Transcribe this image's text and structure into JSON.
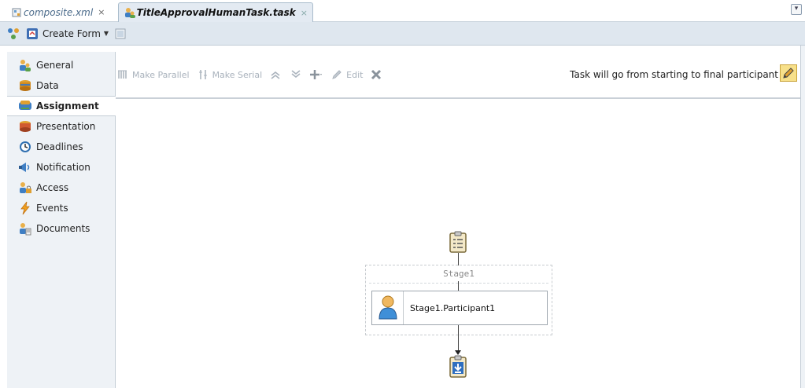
{
  "tabs": [
    {
      "label": "composite.xml",
      "close": "×"
    },
    {
      "label": "TitleApprovalHumanTask.task",
      "close": "×"
    }
  ],
  "toolbar": {
    "create_form_label": "Create Form"
  },
  "nav": {
    "items": [
      {
        "label": "General",
        "icon": "general-icon"
      },
      {
        "label": "Data",
        "icon": "data-icon"
      },
      {
        "label": "Assignment",
        "icon": "assignment-icon",
        "selected": true
      },
      {
        "label": "Presentation",
        "icon": "presentation-icon"
      },
      {
        "label": "Deadlines",
        "icon": "deadlines-icon"
      },
      {
        "label": "Notification",
        "icon": "notification-icon"
      },
      {
        "label": "Access",
        "icon": "access-icon"
      },
      {
        "label": "Events",
        "icon": "events-icon"
      },
      {
        "label": "Documents",
        "icon": "documents-icon"
      }
    ]
  },
  "assignment_toolbar": {
    "make_parallel": "Make Parallel",
    "make_serial": "Make Serial",
    "edit": "Edit",
    "task_info": "Task will go from starting to final participant"
  },
  "diagram": {
    "stage_label": "Stage1",
    "participant_label": "Stage1.Participant1"
  },
  "colors": {
    "selected_tab_bg": "#e3eaf2",
    "toolbar_bg": "#dfe7ef",
    "nav_bg": "#eef2f6",
    "disabled_text": "#a9b2bc",
    "edit_button_bg": "#f7e08a"
  }
}
